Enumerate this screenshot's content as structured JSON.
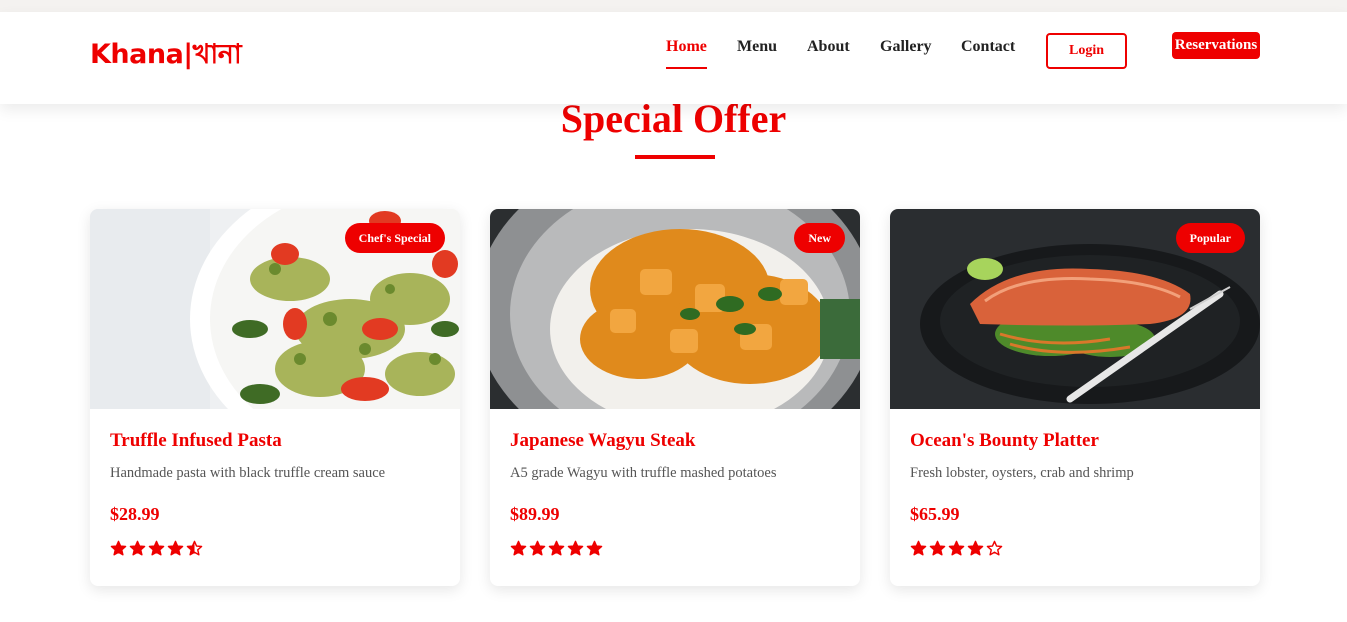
{
  "brand": {
    "logo_text": "Khana|খানা"
  },
  "nav": {
    "links": [
      "Home",
      "Menu",
      "About",
      "Gallery",
      "Contact"
    ],
    "active": "Home",
    "login_label": "Login",
    "reservations_label": "Reservations"
  },
  "section": {
    "title": "Special Offer"
  },
  "colors": {
    "accent": "#ee0000"
  },
  "cards": [
    {
      "badge": "Chef's Special",
      "name": "Truffle Infused Pasta",
      "description": "Handmade pasta with black truffle cream sauce",
      "price": "$28.99",
      "rating": 4.5
    },
    {
      "badge": "New",
      "name": "Japanese Wagyu Steak",
      "description": "A5 grade Wagyu with truffle mashed potatoes",
      "price": "$89.99",
      "rating": 5
    },
    {
      "badge": "Popular",
      "name": "Ocean's Bounty Platter",
      "description": "Fresh lobster, oysters, crab and shrimp",
      "price": "$65.99",
      "rating": 4
    }
  ]
}
